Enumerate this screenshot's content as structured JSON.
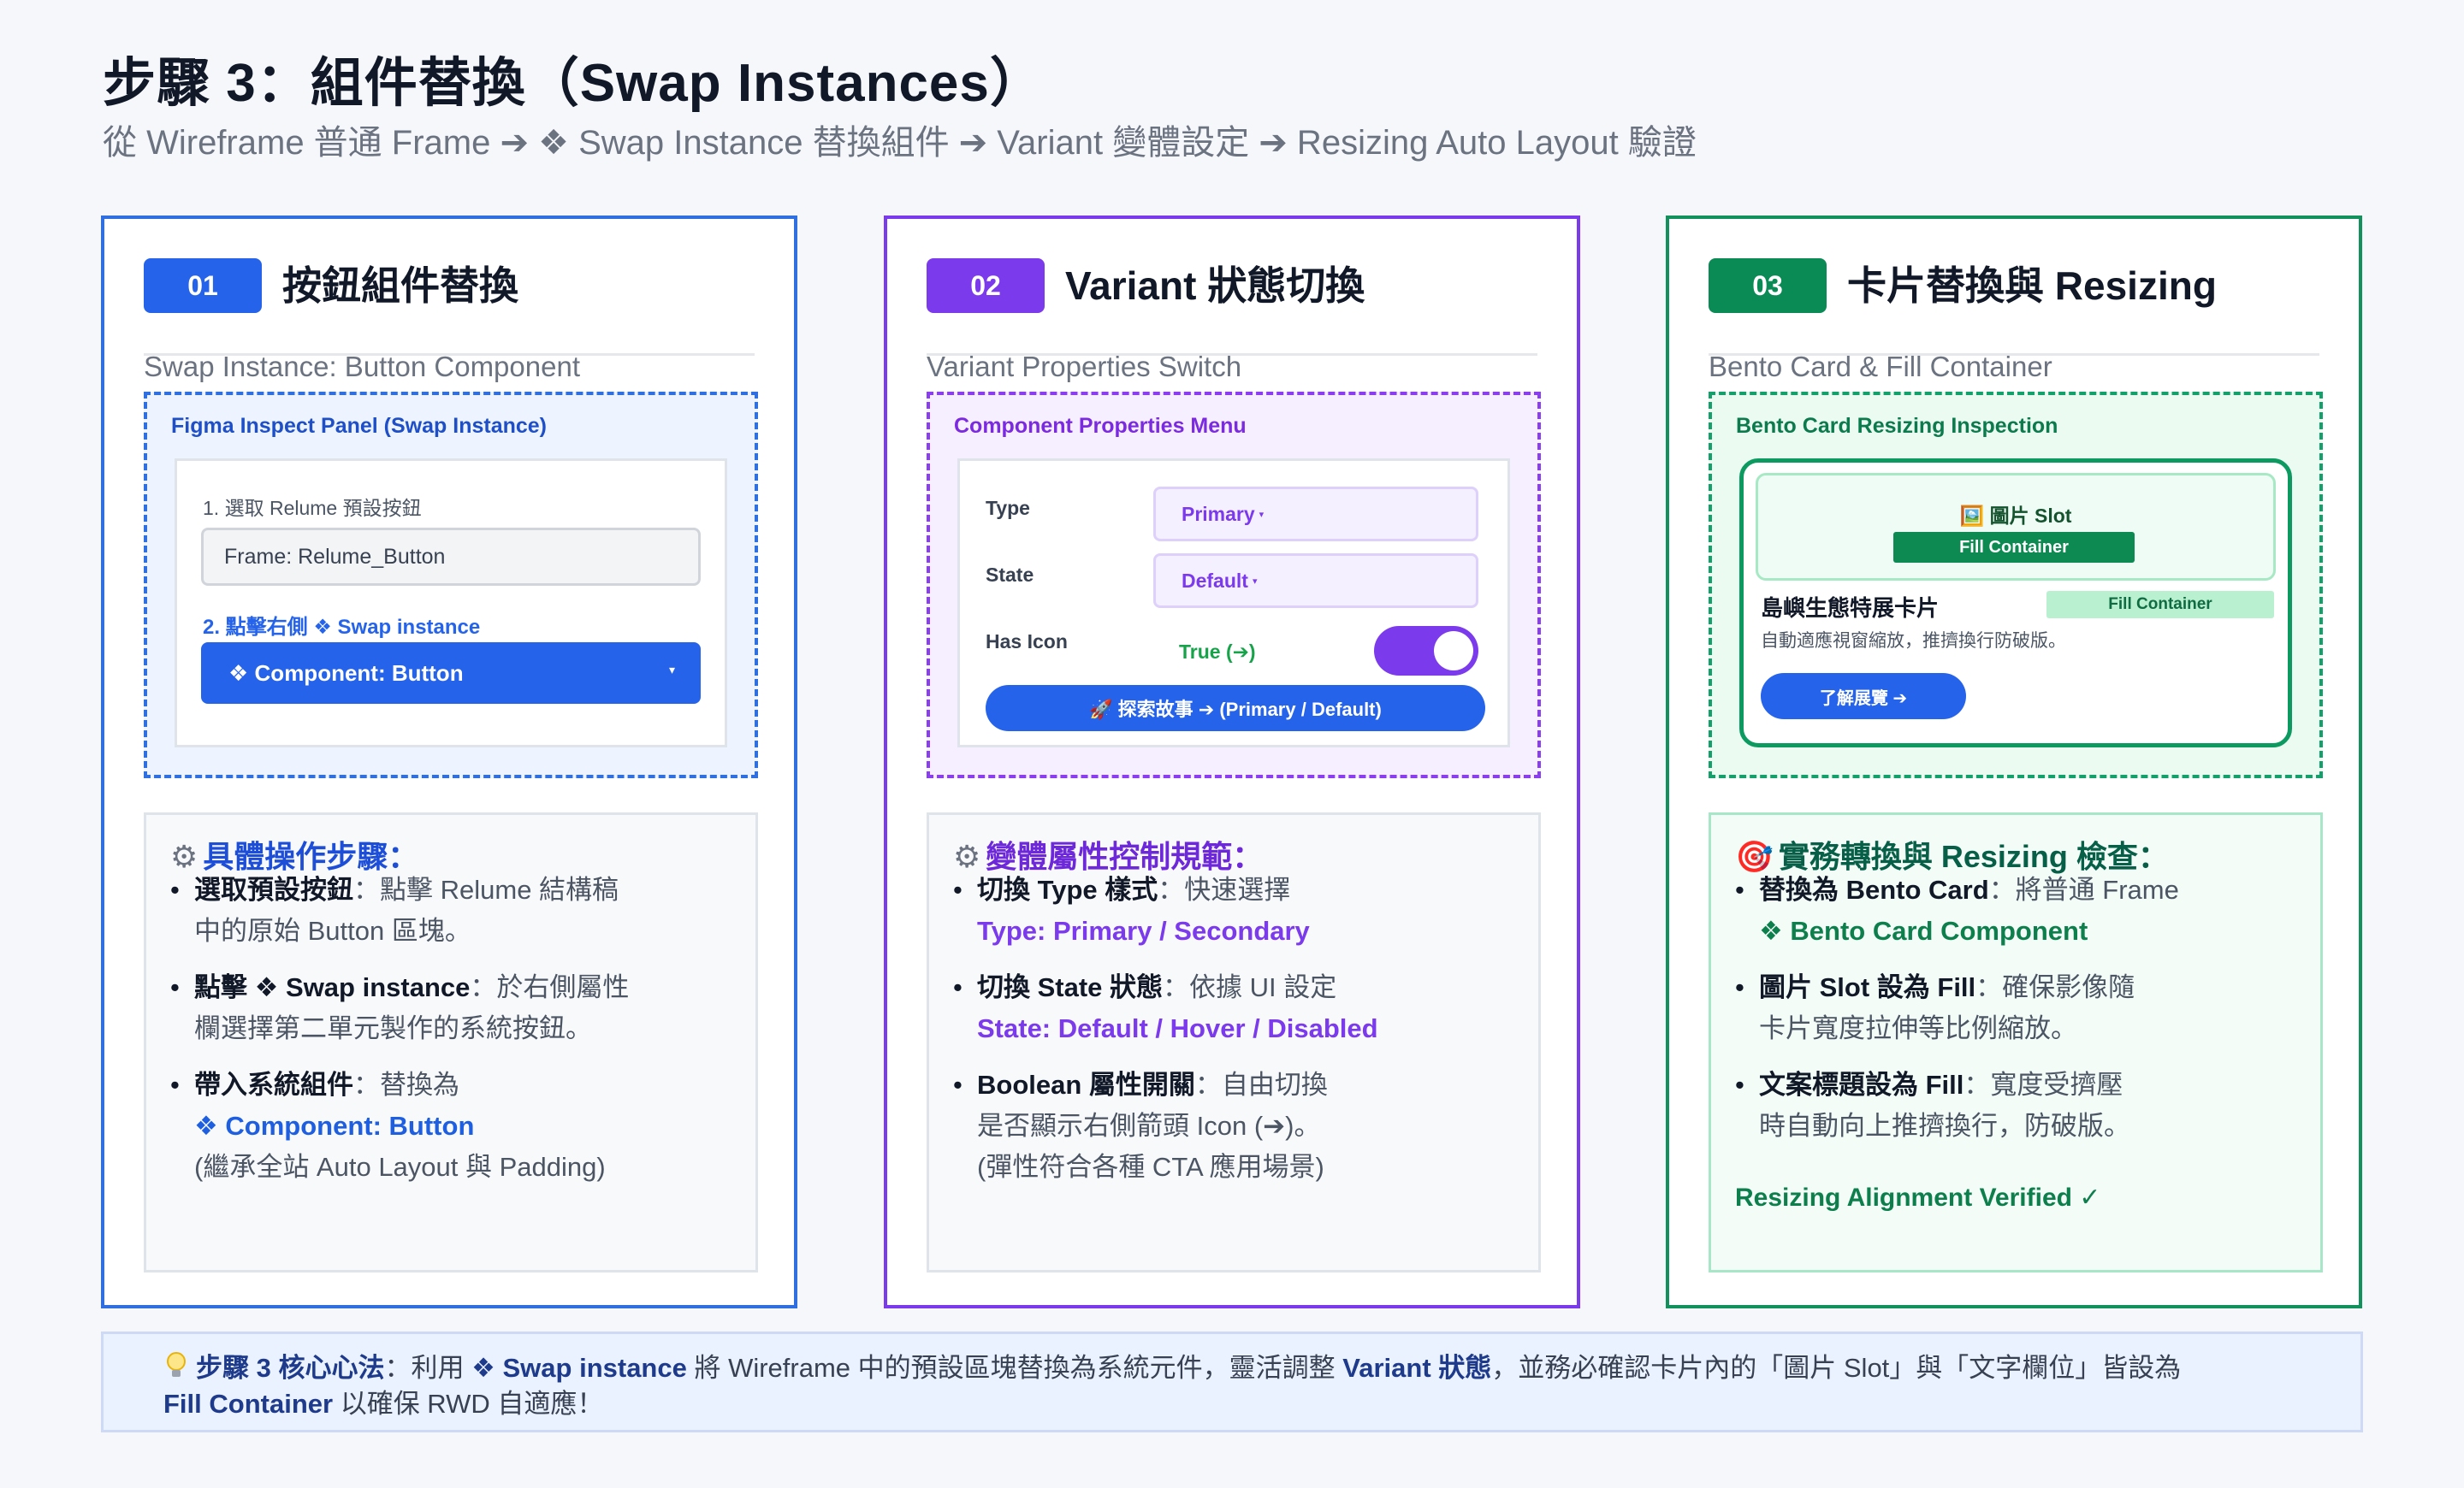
{
  "header": {
    "title": "步驟 3：組件替換（Swap Instances）",
    "subtitle": "從 Wireframe 普通 Frame ➔ ❖ Swap Instance 替換組件 ➔ Variant 變體設定 ➔ Resizing Auto Layout 驗證"
  },
  "colors": {
    "blue": "#2563eb",
    "purple": "#7c3aed",
    "green": "#0a8a55"
  },
  "columns": {
    "c1": {
      "badge": "01",
      "title": "按鈕組件替換",
      "subtitle": "Swap Instance: Button Component",
      "panel_title": "Figma Inspect Panel (Swap Instance)",
      "step1_label": "1. 選取 Relume 預設按鈕",
      "frame_value": "Frame: Relume_Button",
      "step2_label": "2. 點擊右側 ❖ Swap instance",
      "select_value": "❖ Component: Button",
      "select_caret": "▾",
      "steps_title": "具體操作步驟：",
      "steps": [
        {
          "bold": "選取預設按鈕",
          "l1": "：點擊 Relume 結構稿",
          "l2": "中的原始 Button 區塊。"
        },
        {
          "bold": "點擊 ❖ Swap instance",
          "l1": "：於右側屬性",
          "l2": "欄選擇第二單元製作的系統按鈕。"
        },
        {
          "bold": "帶入系統組件",
          "l1": "：替換為",
          "l2": "❖ Component: Button",
          "l3": "(繼承全站 Auto Layout 與 Padding)"
        }
      ]
    },
    "c2": {
      "badge": "02",
      "title": "Variant 狀態切換",
      "subtitle": "Variant Properties Switch",
      "panel_title": "Component Properties Menu",
      "props": [
        {
          "label": "Type",
          "value": "Primary"
        },
        {
          "label": "State",
          "value": "Default"
        },
        {
          "label": "Has Icon",
          "value": "True (➔)"
        }
      ],
      "dropdown_marker": "▾",
      "cta": "🚀 探索故事 ➔ (Primary / Default)",
      "steps_title": "變體屬性控制規範：",
      "steps": [
        {
          "bold": "切換 Type 樣式",
          "l1": "：快速選擇",
          "l2": "Type: Primary / Secondary"
        },
        {
          "bold": "切換 State 狀態",
          "l1": "：依據 UI 設定",
          "l2": "State: Default / Hover / Disabled"
        },
        {
          "bold": "Boolean 屬性開關",
          "l1": "：自由切換",
          "l2": "是否顯示右側箭頭 Icon (➔)。",
          "l3": "(彈性符合各種 CTA 應用場景)"
        }
      ]
    },
    "c3": {
      "badge": "03",
      "title": "卡片替換與 Resizing",
      "subtitle": "Bento Card & Fill Container",
      "panel_title": "Bento Card Resizing Inspection",
      "img_slot": "🖼️ 圖片 Slot",
      "fill_tag": "Fill Container",
      "card_title": "島嶼生態特展卡片",
      "fill_tag2": "Fill Container",
      "card_desc": "自動適應視窗縮放，推擠換行防破版。",
      "card_button": "了解展覽 ➔",
      "steps_title": "實務轉換與 Resizing 檢查：",
      "steps": [
        {
          "bold": "替換為 Bento Card",
          "l1": "：將普通 Frame",
          "l2": "❖ Bento Card Component"
        },
        {
          "bold": "圖片 Slot 設為 Fill",
          "l1": "：確保影像隨",
          "l2": "卡片寬度拉伸等比例縮放。"
        },
        {
          "bold": "文案標題設為 Fill",
          "l1": "：寬度受擠壓",
          "l2": "時自動向上推擠換行，防破版。"
        }
      ],
      "verified": "Resizing Alignment Verified ✓"
    }
  },
  "footer": {
    "bold1": "步驟 3 核心心法",
    "t1": "：利用 ",
    "bold2": "❖ Swap instance",
    "t2": " 將 Wireframe 中的預設區塊替換為系統元件，靈活調整 ",
    "bold3": "Variant 狀態",
    "t3": "，並務必確認卡片內的「圖片 Slot」與「文字欄位」皆設為",
    "bold4": "Fill Container",
    "t4": " 以確保 RWD 自適應！"
  }
}
